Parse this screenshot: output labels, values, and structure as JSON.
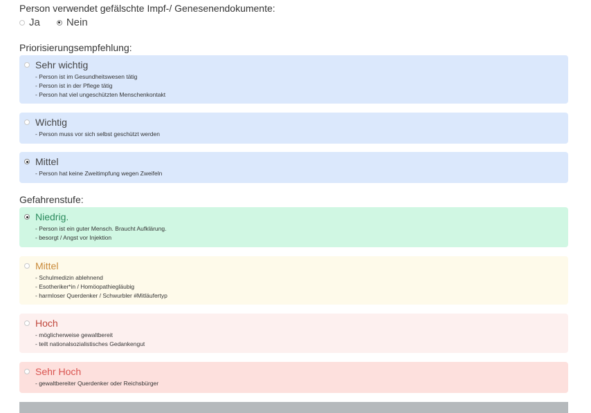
{
  "fake_docs": {
    "question": "Person verwendet gefälschte Impf-/ Genesenendokumente:",
    "options": [
      {
        "label": "Ja",
        "checked": false
      },
      {
        "label": "Nein",
        "checked": true
      }
    ]
  },
  "priority": {
    "question": "Priorisierungsempfehlung:",
    "options": [
      {
        "title": "Sehr wichtig",
        "checked": false,
        "color": "#dbe8fc",
        "desc": [
          "- Person ist im Gesundheitswesen tätig",
          "- Person ist in der Pflege tätig",
          "- Person hat viel ungeschützten Menschenkontakt"
        ]
      },
      {
        "title": "Wichtig",
        "checked": false,
        "color": "#dbe8fc",
        "desc": [
          "- Person muss vor sich selbst geschützt werden"
        ]
      },
      {
        "title": "Mittel",
        "checked": true,
        "color": "#dbe8fc",
        "desc": [
          "- Person hat keine Zweitimpfung wegen Zweifeln"
        ]
      }
    ]
  },
  "danger": {
    "question": "Gefahrenstufe:",
    "options": [
      {
        "title": "Niedrig.",
        "checked": true,
        "color": "#d0f7e3",
        "desc": [
          "- Person ist ein guter Mensch. Braucht Aufklärung.",
          "- besorgt / Angst vor Injektion"
        ]
      },
      {
        "title": "Mittel",
        "checked": false,
        "color": "#fefaea",
        "desc": [
          "- Schulmedizin ablehnend",
          "- Esotheriker*in / Homöopathiegläubig",
          "- harmloser Querdenker / Schwurbler #Mitläufertyp"
        ]
      },
      {
        "title": "Hoch",
        "checked": false,
        "color": "#fdf0ef",
        "desc": [
          "- möglicherweise gewaltbereit",
          "- teilt nationalsozialistisches Gedankengut"
        ]
      },
      {
        "title": "Sehr Hoch",
        "checked": false,
        "color": "#fde0dd",
        "desc": [
          "- gewaltbereiter Querdenker oder Reichsbürger"
        ]
      }
    ]
  }
}
